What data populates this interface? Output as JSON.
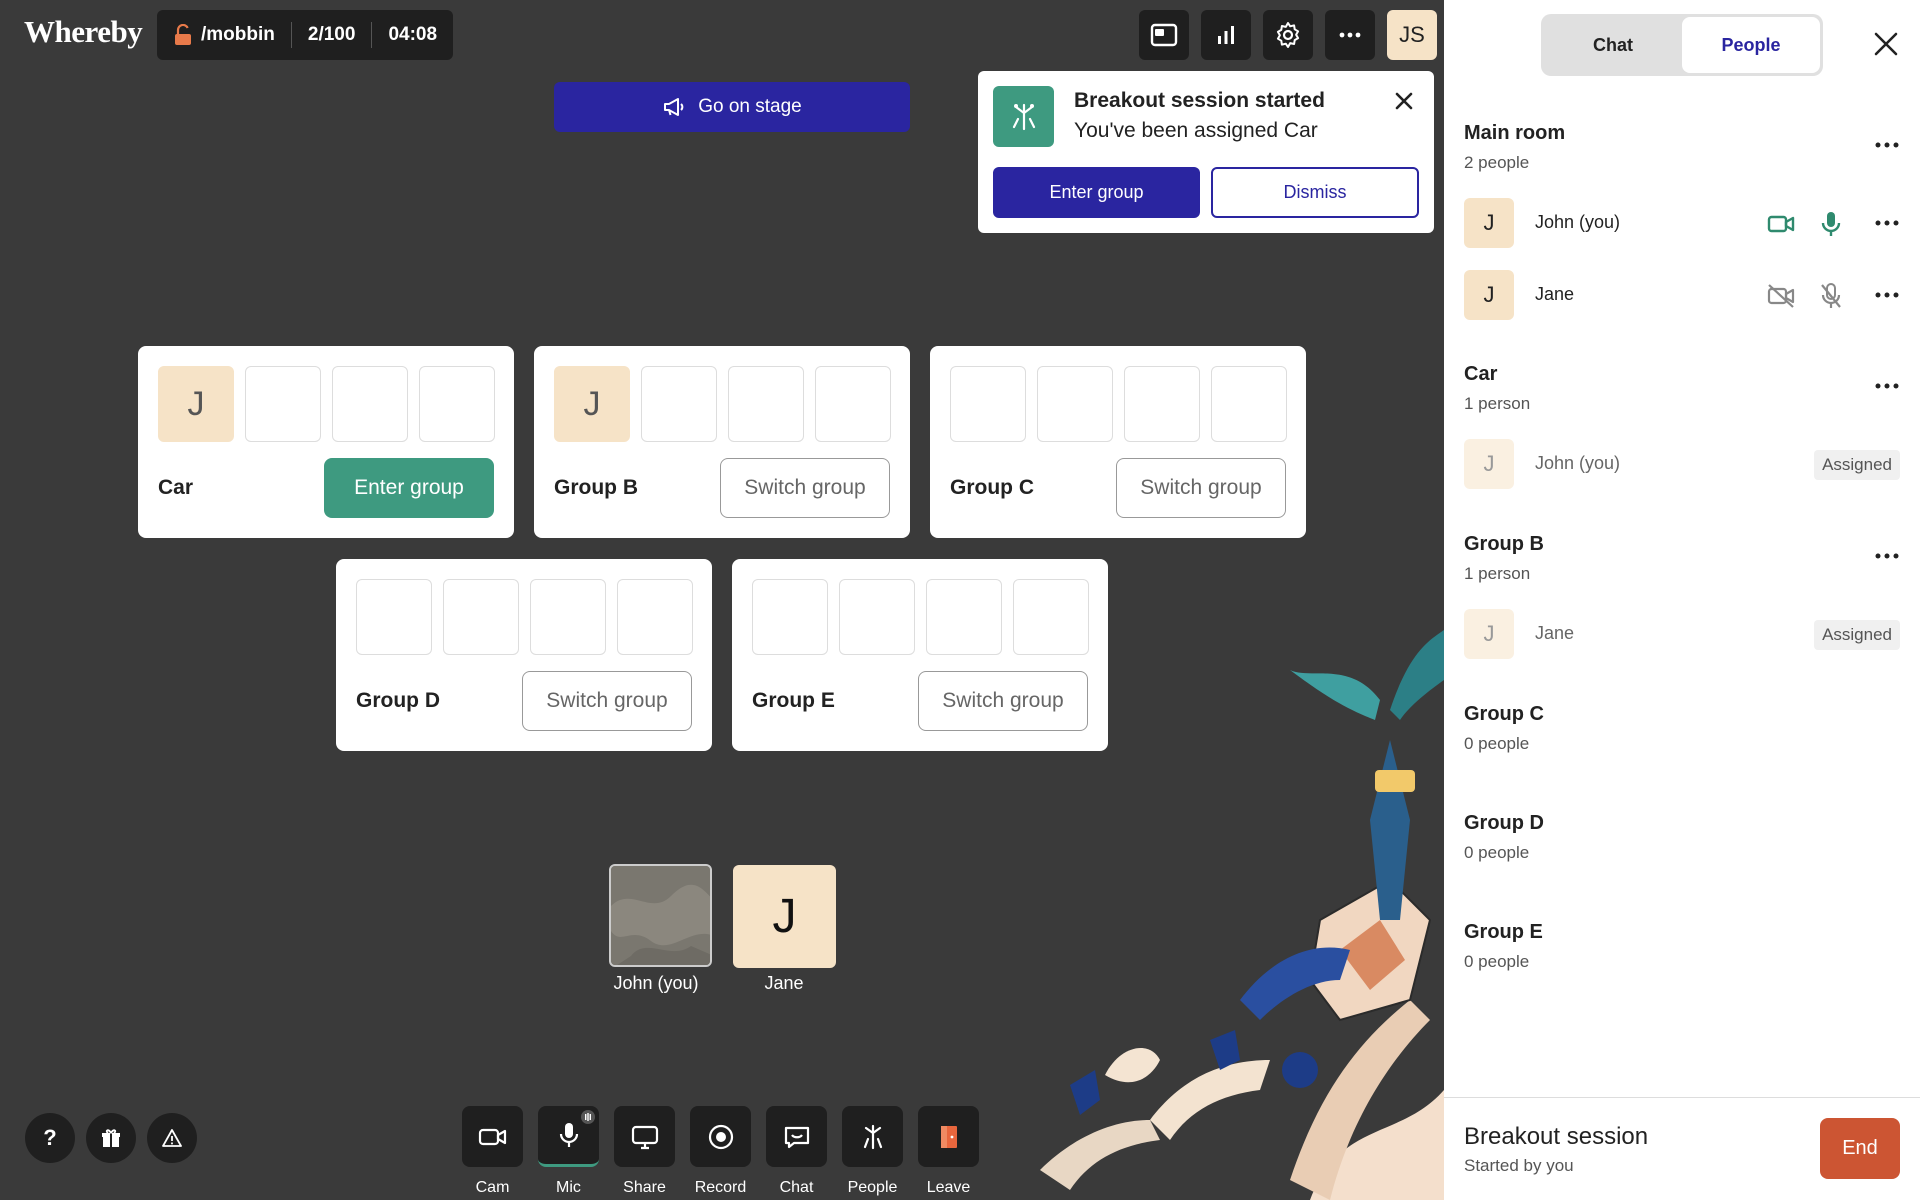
{
  "app": {
    "logo": "Whereby"
  },
  "room": {
    "name": "/mobbin",
    "capacity": "2/100",
    "timer": "04:08"
  },
  "header": {
    "avatar_initials": "JS"
  },
  "stage": {
    "label": "Go on stage"
  },
  "notification": {
    "title": "Breakout session started",
    "subtitle": "You've been assigned Car",
    "enter_label": "Enter group",
    "dismiss_label": "Dismiss"
  },
  "groups": [
    {
      "name": "Car",
      "button": "Enter group",
      "slots": [
        "J",
        "",
        "",
        ""
      ]
    },
    {
      "name": "Group B",
      "button": "Switch group",
      "slots": [
        "J",
        "",
        "",
        ""
      ]
    },
    {
      "name": "Group C",
      "button": "Switch group",
      "slots": [
        "",
        "",
        "",
        ""
      ]
    },
    {
      "name": "Group D",
      "button": "Switch group",
      "slots": [
        "",
        "",
        "",
        ""
      ]
    },
    {
      "name": "Group E",
      "button": "Switch group",
      "slots": [
        "",
        "",
        "",
        ""
      ]
    }
  ],
  "participants": [
    {
      "name": "John (you)",
      "initial": ""
    },
    {
      "name": "Jane",
      "initial": "J"
    }
  ],
  "bottom_left": {
    "help": "?"
  },
  "toolbar": {
    "cam": "Cam",
    "mic": "Mic",
    "share": "Share",
    "record": "Record",
    "chat": "Chat",
    "people": "People",
    "leave": "Leave"
  },
  "panel": {
    "tabs": {
      "chat": "Chat",
      "people": "People"
    },
    "main_room": {
      "title": "Main room",
      "count": "2 people",
      "members": [
        {
          "initial": "J",
          "name": "John (you)"
        },
        {
          "initial": "J",
          "name": "Jane"
        }
      ]
    },
    "car": {
      "title": "Car",
      "count": "1 person",
      "member": {
        "initial": "J",
        "name": "John (you)",
        "status": "Assigned"
      }
    },
    "group_b": {
      "title": "Group B",
      "count": "1 person",
      "member": {
        "initial": "J",
        "name": "Jane",
        "status": "Assigned"
      }
    },
    "group_c": {
      "title": "Group C",
      "count": "0 people"
    },
    "group_d": {
      "title": "Group D",
      "count": "0 people"
    },
    "group_e": {
      "title": "Group E",
      "count": "0 people"
    },
    "footer": {
      "title": "Breakout session",
      "subtitle": "Started by you",
      "end_label": "End"
    }
  },
  "colors": {
    "accent": "#2a25a0",
    "green": "#3e9a80",
    "danger": "#cc5533",
    "avatar": "#f6e3c7",
    "background": "#3a3a3a"
  }
}
